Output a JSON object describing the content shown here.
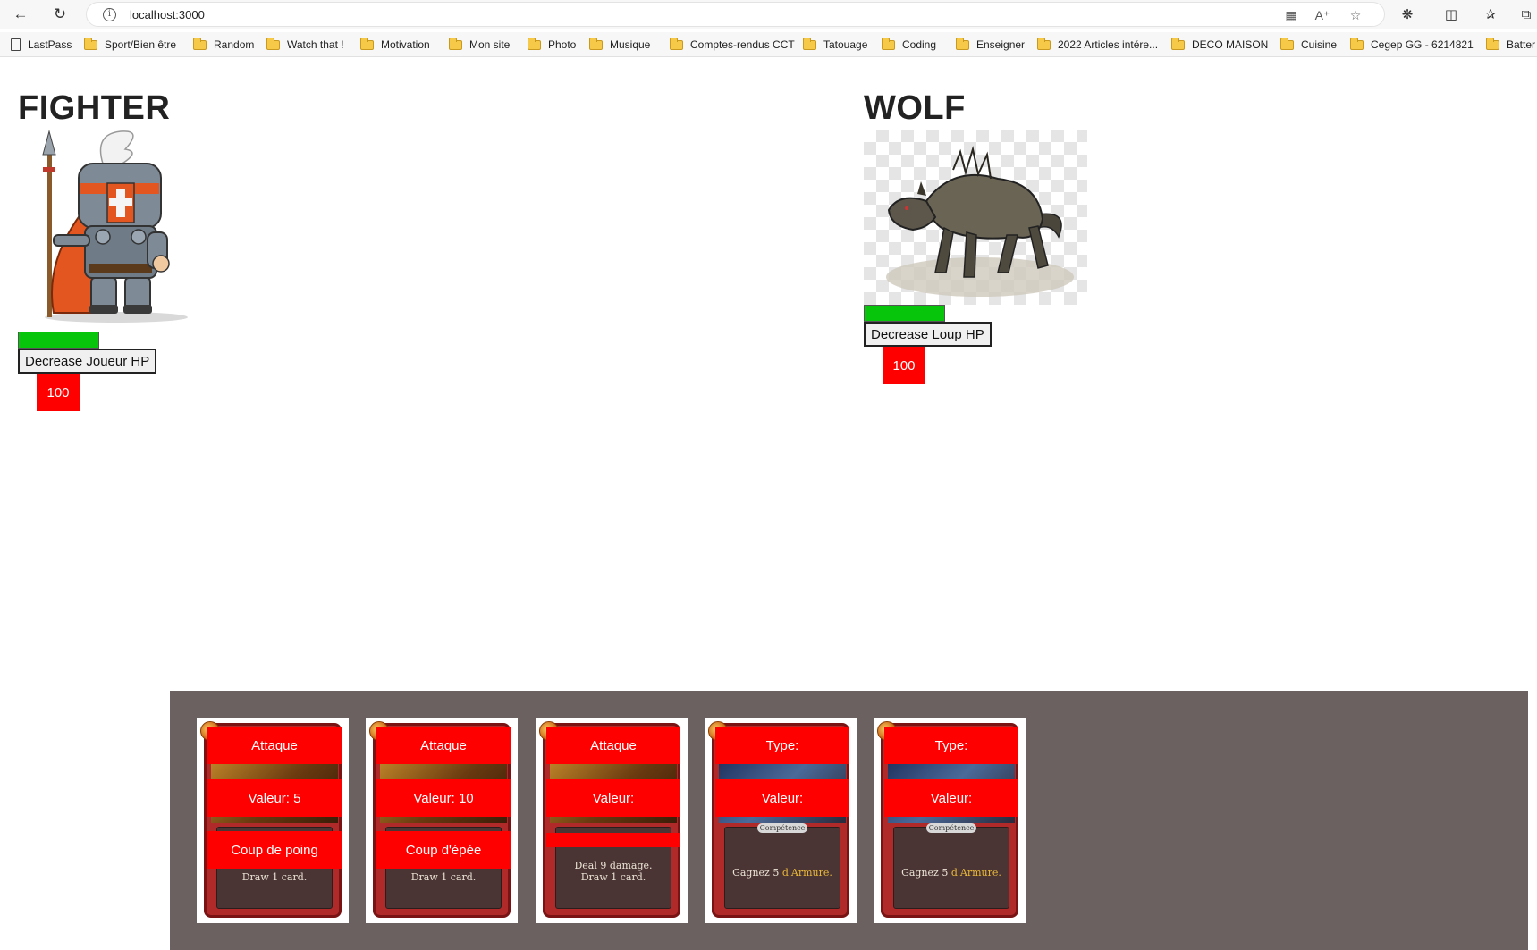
{
  "browser": {
    "url": "localhost:3000",
    "bookmarks": [
      {
        "label": "LastPass",
        "icon": "page-icon"
      },
      {
        "label": "Sport/Bien être",
        "icon": "folder-icon"
      },
      {
        "label": "Random",
        "icon": "folder-icon"
      },
      {
        "label": "Watch that !",
        "icon": "folder-icon"
      },
      {
        "label": "Motivation",
        "icon": "folder-icon"
      },
      {
        "label": "Mon site",
        "icon": "folder-icon"
      },
      {
        "label": "Photo",
        "icon": "folder-icon"
      },
      {
        "label": "Musique",
        "icon": "folder-icon"
      },
      {
        "label": "Comptes-rendus CCT",
        "icon": "folder-icon"
      },
      {
        "label": "Tatouage",
        "icon": "folder-icon"
      },
      {
        "label": "Coding",
        "icon": "folder-icon"
      },
      {
        "label": "Enseigner",
        "icon": "folder-icon"
      },
      {
        "label": "2022 Articles intére...",
        "icon": "folder-icon"
      },
      {
        "label": "DECO MAISON",
        "icon": "folder-icon"
      },
      {
        "label": "Cuisine",
        "icon": "folder-icon"
      },
      {
        "label": "Cegep GG - 6214821",
        "icon": "folder-icon"
      },
      {
        "label": "Batter",
        "icon": "folder-icon"
      }
    ]
  },
  "player": {
    "name": "FIGHTER",
    "hp_fraction": 1.0,
    "button_label": "Decrease Joueur HP",
    "hp_value": "100"
  },
  "enemy": {
    "name": "WOLF",
    "hp_fraction": 1.0,
    "button_label": "Decrease Loup HP",
    "hp_value": "100"
  },
  "cards": [
    {
      "type": "Attaque",
      "value": "Valeur: 5",
      "name": "Coup de poing",
      "art": "gold",
      "desc": "Draw 1 card.",
      "desc2": "",
      "tag": ""
    },
    {
      "type": "Attaque",
      "value": "Valeur: 10",
      "name": "Coup d'épée",
      "art": "gold",
      "desc": "Draw 1 card.",
      "desc2": "",
      "tag": ""
    },
    {
      "type": "Attaque",
      "value": "Valeur:",
      "name": "",
      "art": "gold",
      "desc": "Deal 9 damage.",
      "desc2": "Draw 1 card.",
      "tag": ""
    },
    {
      "type": "Type:",
      "value": "Valeur:",
      "name": "",
      "art": "blue",
      "desc": "Gagnez 5 ",
      "desc_hl": "d'Armure.",
      "tag": "Compétence"
    },
    {
      "type": "Type:",
      "value": "Valeur:",
      "name": "",
      "art": "blue",
      "desc": "Gagnez 5 ",
      "desc_hl": "d'Armure.",
      "tag": "Compétence"
    }
  ],
  "colors": {
    "hp_bar": "#06c50b",
    "badge_red": "#ff0000",
    "hand_background": "#6b6161"
  }
}
